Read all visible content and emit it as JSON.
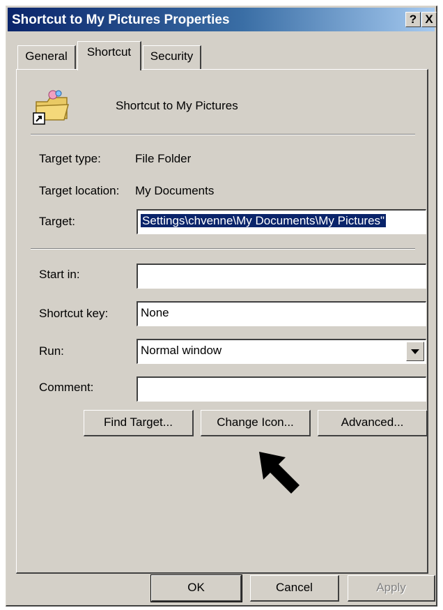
{
  "window": {
    "title": "Shortcut to My Pictures Properties",
    "help_button": "?",
    "close_button": "X"
  },
  "tabs": [
    {
      "label": "General",
      "active": false
    },
    {
      "label": "Shortcut",
      "active": true
    },
    {
      "label": "Security",
      "active": false
    }
  ],
  "shortcut": {
    "name": "Shortcut to My Pictures",
    "icon": "folder-pictures-shortcut-icon",
    "target_type_label": "Target type:",
    "target_type_value": "File Folder",
    "target_location_label": "Target location:",
    "target_location_value": "My Documents",
    "target_label": "Target:",
    "target_value": "Settings\\chvenne\\My Documents\\My Pictures\"",
    "start_in_label": "Start in:",
    "start_in_value": "",
    "shortcut_key_label": "Shortcut key:",
    "shortcut_key_value": "None",
    "run_label": "Run:",
    "run_value": "Normal window",
    "comment_label": "Comment:",
    "comment_value": ""
  },
  "panel_buttons": {
    "find_target": "Find Target...",
    "change_icon": "Change Icon...",
    "advanced": "Advanced..."
  },
  "footer_buttons": {
    "ok": "OK",
    "cancel": "Cancel",
    "apply": "Apply"
  },
  "colors": {
    "titlebar_start": "#0a246a",
    "titlebar_end": "#a6caf0",
    "dialog_face": "#d4d0c8",
    "selection": "#0a246a"
  }
}
